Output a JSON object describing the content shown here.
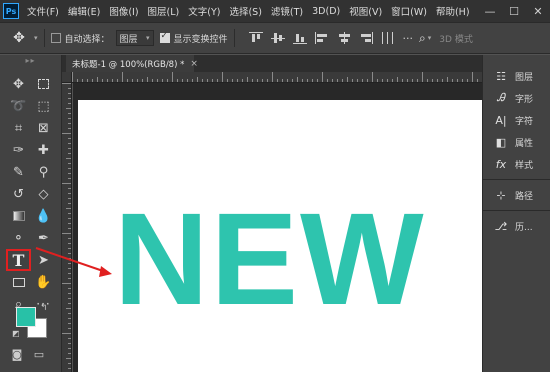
{
  "app": {
    "logo": "Ps",
    "menu": [
      "文件(F)",
      "编辑(E)",
      "图像(I)",
      "图层(L)",
      "文字(Y)",
      "选择(S)",
      "滤镜(T)",
      "3D(D)",
      "视图(V)",
      "窗口(W)",
      "帮助(H)"
    ],
    "window_controls": [
      "—",
      "☐",
      "✕"
    ]
  },
  "options_bar": {
    "auto_select_label": "自动选择：",
    "auto_select_checked": false,
    "layer_select_value": "图层",
    "show_transform_label": "显示变换控件",
    "show_transform_checked": true,
    "mode_3d_label": "3D 模式"
  },
  "document": {
    "tab_title": "未标题-1 @ 100%(RGB/8) *",
    "tab_close": "×",
    "canvas_text": "NEW",
    "canvas_text_color": "#2ec4ae"
  },
  "toolbar": {
    "foreground_color": "#28c1a7",
    "background_color": "#ffffff",
    "highlighted_tool": "T"
  },
  "right_panels": {
    "items": [
      {
        "icon": "☷",
        "label": "图层"
      },
      {
        "icon": "A",
        "label": "字形"
      },
      {
        "icon": "A|",
        "label": "字符"
      },
      {
        "icon": "◧",
        "label": "属性"
      },
      {
        "icon": "fx",
        "label": "样式"
      },
      {
        "icon": "⊹",
        "label": "路径"
      },
      {
        "icon": "⎇",
        "label": "历..."
      }
    ]
  },
  "annotation": {
    "arrow_color": "#e02020"
  }
}
